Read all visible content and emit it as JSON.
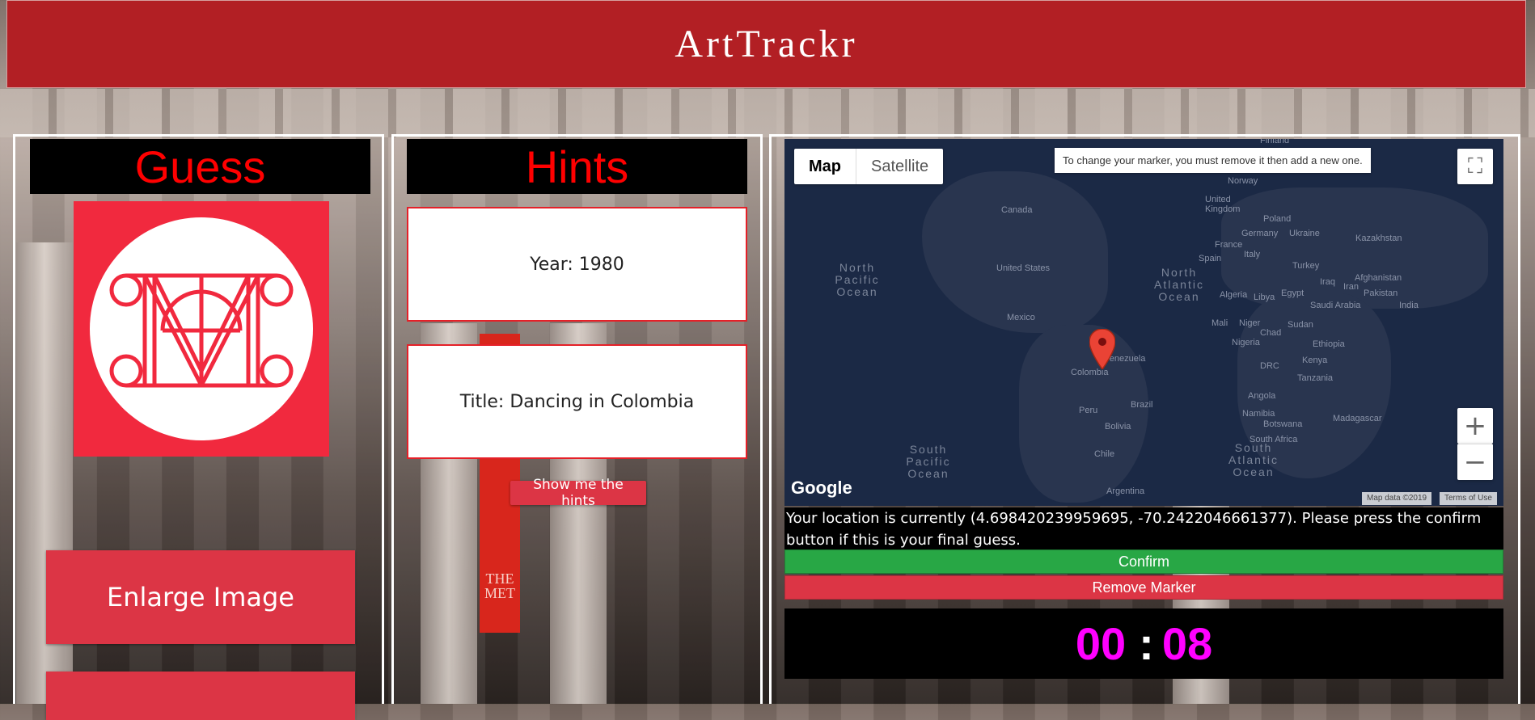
{
  "app": {
    "title": "ArtTrackr"
  },
  "guess_panel": {
    "heading": "Guess",
    "logo_icon": "met-museum-logo-icon",
    "enlarge_label": "Enlarge Image"
  },
  "hints_panel": {
    "heading": "Hints",
    "hints": [
      {
        "label": "Year: 1980"
      },
      {
        "label": "Title: Dancing in Colombia"
      }
    ],
    "show_hints_label": "Show me the hints",
    "banner_text": "THE MET"
  },
  "map_panel": {
    "map_type": {
      "map_label": "Map",
      "satellite_label": "Satellite",
      "selected": "Map"
    },
    "tooltip": "To change your marker, you must remove it then add a new one.",
    "logo": "Google",
    "attribution": {
      "data": "Map data ©2019",
      "terms": "Terms of Use"
    },
    "labels": {
      "north_pacific": "North Pacific Ocean",
      "north_atlantic": "North Atlantic Ocean",
      "south_pacific": "South Pacific Ocean",
      "south_atlantic": "South Atlantic Ocean",
      "canada": "Canada",
      "united_states": "United States",
      "mexico": "Mexico",
      "venezuela": "Venezuela",
      "colombia": "Colombia",
      "peru": "Peru",
      "brazil": "Brazil",
      "bolivia": "Bolivia",
      "chile": "Chile",
      "argentina": "Argentina",
      "finland": "Finland",
      "norway": "Norway",
      "united_kingdom": "United Kingdom",
      "poland": "Poland",
      "germany": "Germany",
      "ukraine": "Ukraine",
      "kazakhstan": "Kazakhstan",
      "france": "France",
      "spain": "Spain",
      "italy": "Italy",
      "turkey": "Turkey",
      "iraq": "Iraq",
      "afghanistan": "Afghanistan",
      "iran": "Iran",
      "pakistan": "Pakistan",
      "india": "India",
      "algeria": "Algeria",
      "libya": "Libya",
      "egypt": "Egypt",
      "saudi_arabia": "Saudi Arabia",
      "mali": "Mali",
      "niger": "Niger",
      "chad": "Chad",
      "sudan": "Sudan",
      "nigeria": "Nigeria",
      "ethiopia": "Ethiopia",
      "drc": "DRC",
      "kenya": "Kenya",
      "tanzania": "Tanzania",
      "angola": "Angola",
      "namibia": "Namibia",
      "botswana": "Botswana",
      "madagascar": "Madagascar",
      "south_africa": "South Africa"
    },
    "marker_icon": "map-pin-icon",
    "location_text": "Your location is currently (4.698420239959695, -70.2422046661377). Please press the confirm button if this is your final guess.",
    "confirm_label": "Confirm",
    "remove_label": "Remove Marker"
  },
  "timer": {
    "minutes": "00",
    "separator": ":",
    "seconds": "08"
  },
  "colors": {
    "header": "#b21f24",
    "accent_red": "#dc3545",
    "confirm_green": "#28a745",
    "timer_magenta": "#ff00ff"
  }
}
